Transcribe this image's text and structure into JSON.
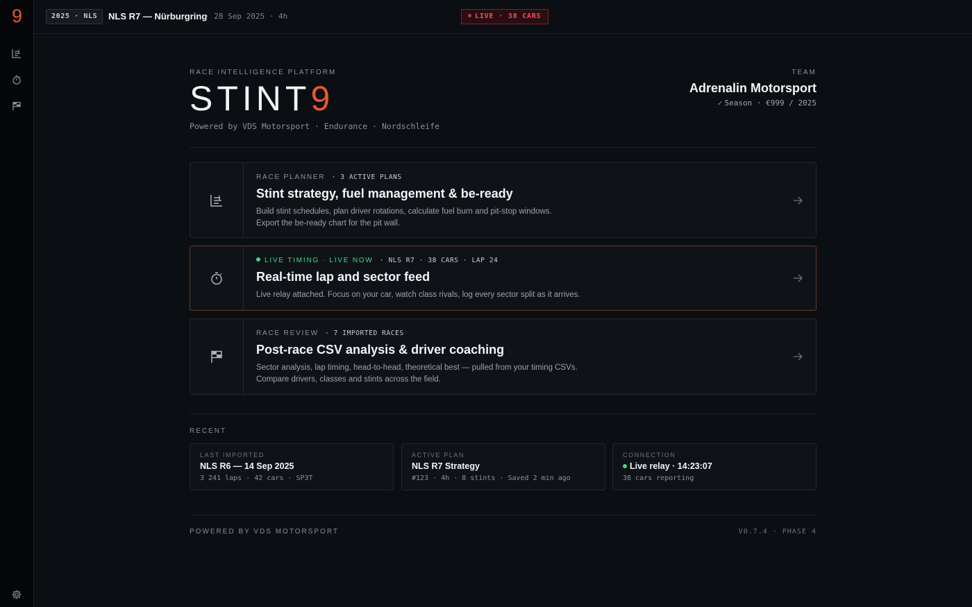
{
  "rail": {
    "logo": "9",
    "icons": [
      "planner-icon",
      "stopwatch-icon",
      "flag-icon",
      "settings-icon"
    ]
  },
  "topbar": {
    "season_chip": "2025 · NLS",
    "event_title": "NLS R7 — Nürburgring",
    "event_meta": "· 28 Sep 2025 · 4h",
    "live_chip": "LIVE · 38 CARS"
  },
  "header": {
    "eyebrow": "RACE INTELLIGENCE PLATFORM",
    "brand_main": "STINT",
    "brand_accent": "9",
    "powered": "Powered by VDS Motorsport · Endurance · Nordschleife",
    "team_label": "TEAM",
    "team_name": "Adrenalin Motorsport",
    "team_meta": "Season · €999 / 2025"
  },
  "modules": [
    {
      "kicker": "RACE PLANNER",
      "sub": "· 3 ACTIVE PLANS",
      "title": "Stint strategy, fuel management & be-ready",
      "desc_1": "Build stint schedules, plan driver rotations, calculate fuel burn and pit-stop windows.",
      "desc_2": "Export the be-ready chart for the pit wall.",
      "icon": "planner-icon"
    },
    {
      "kicker": "LIVE TIMING · LIVE NOW",
      "sub": "· NLS R7 · 38 CARS · LAP 24",
      "title": "Real-time lap and sector feed",
      "desc_1": "Live relay attached. Focus on your car, watch class rivals, log every sector split as it arrives.",
      "desc_2": "",
      "icon": "stopwatch-icon"
    },
    {
      "kicker": "RACE REVIEW",
      "sub": "· 7 IMPORTED RACES",
      "title": "Post-race CSV analysis & driver coaching",
      "desc_1": "Sector analysis, lap timing, head-to-head, theoretical best — pulled from your timing CSVs.",
      "desc_2": "Compare drivers, classes and stints across the field.",
      "icon": "flag-icon"
    }
  ],
  "recent": {
    "label": "RECENT",
    "items": [
      {
        "kicker": "LAST IMPORTED",
        "title": "NLS R6 — 14 Sep 2025",
        "sub": "3 241 laps · 42 cars · SP3T"
      },
      {
        "kicker": "ACTIVE PLAN",
        "title": "NLS R7 Strategy",
        "sub": "#123 · 4h · 8 stints · Saved 2 min ago"
      },
      {
        "kicker": "CONNECTION",
        "title": "Live relay · 14:23:07",
        "sub": "38 cars reporting"
      }
    ]
  },
  "footer": {
    "left": "POWERED BY VDS MOTORSPORT",
    "right": "V0.7.4 · PHASE 4"
  },
  "colors": {
    "accent": "#e8572f",
    "live_red": "#ff4d5c",
    "live_green": "#3ddc84",
    "background": "#0b0e12"
  }
}
